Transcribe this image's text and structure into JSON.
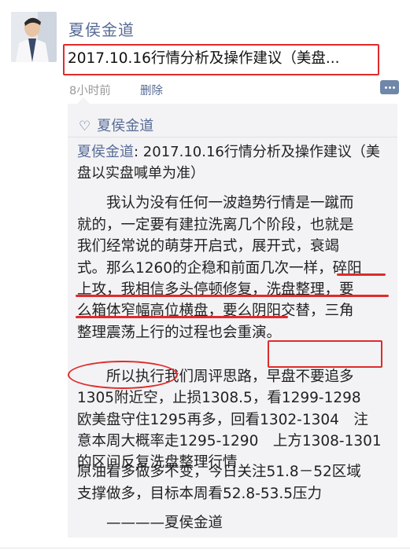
{
  "post": {
    "author": "夏侯金道",
    "title": "2017.10.16行情分析及操作建议（美盘...",
    "time": "8小时前",
    "delete_label": "删除"
  },
  "likes": {
    "name": "夏侯金道"
  },
  "comment": {
    "author": "夏侯金道",
    "sep": ": ",
    "head": "2017.10.16行情分析及操作建议（美盘以实盘喊单为准）",
    "p1": [
      "　　我认为没有任何一波趋势行情是一蹴而",
      "就的，一定要有建拉洗离几个阶段，也就是",
      "我们经常说的萌芽开启式，展开式，衰竭",
      "式。那么1260的企稳和前面几次一样，碎阳",
      "上攻，我相信多头停顿修复，洗盘整理，要",
      "么箱体窄幅高位横盘，要么阴阳交替，三角",
      "整理震荡上行的过程也会重演。"
    ],
    "p2": [
      "　　所以执行我们周评思路，早盘不要追多",
      "1305附近空，止损1308.5，看1299-1298",
      "欧美盘守住1295再多，回看1302-1304　注",
      "意本周大概率走1295-1290　上方1308-1301",
      "的区间反复洗盘整理行情"
    ],
    "p3": [
      "原油看多做多不变，今日关注51.8－52区域",
      "支撑做多，目标本周看52.8-53.5压力"
    ],
    "signature": "　　————夏侯金道"
  },
  "icons": {
    "heart": "heart-outline-icon",
    "more": "more-dots-icon"
  },
  "colors": {
    "link": "#576b95",
    "annotation": "#e02b2b",
    "panel": "#f3f3f5"
  }
}
